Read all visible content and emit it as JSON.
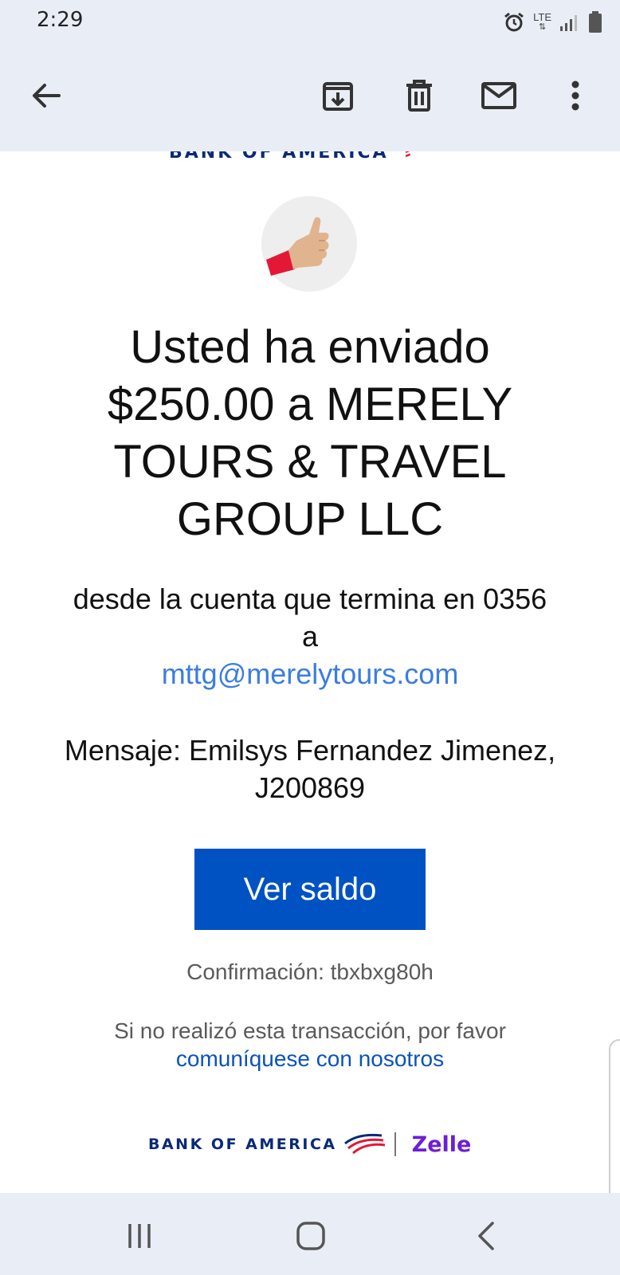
{
  "status_bar": {
    "time": "2:29",
    "network": "LTE"
  },
  "app_bar": {
    "icons": [
      "back-arrow-icon",
      "archive-icon",
      "delete-icon",
      "mark-unread-icon",
      "more-vert-icon"
    ]
  },
  "email": {
    "header_logo_text": "BANK OF AMERICA",
    "hero_icon": "thumbs-up-icon",
    "headline": "Usted ha enviado $250.00 a MERELY TOURS & TRAVEL GROUP LLC",
    "detail_prefix": "desde la cuenta que termina en 0356 a",
    "recipient_email": "mttg@merelytours.com",
    "message": "Mensaje: Emilsys Fernandez Jimenez, J200869",
    "cta_label": "Ver saldo",
    "confirmation": "Confirmación: tbxbxg80h",
    "disclaimer_text": "Si no realizó esta transacción, por favor",
    "contact_link": "comuníquese con nosotros",
    "footer_bank": "BANK OF AMERICA",
    "footer_partner": "Zelle",
    "colors": {
      "link": "#3a7de0",
      "cta_background": "#0052c2",
      "bank_navy": "#0a2a78",
      "bank_red": "#e31837",
      "zelle_purple": "#6d1ed4"
    }
  },
  "nav_bar": {
    "icons": [
      "recent-apps-icon",
      "home-icon",
      "back-icon"
    ]
  }
}
